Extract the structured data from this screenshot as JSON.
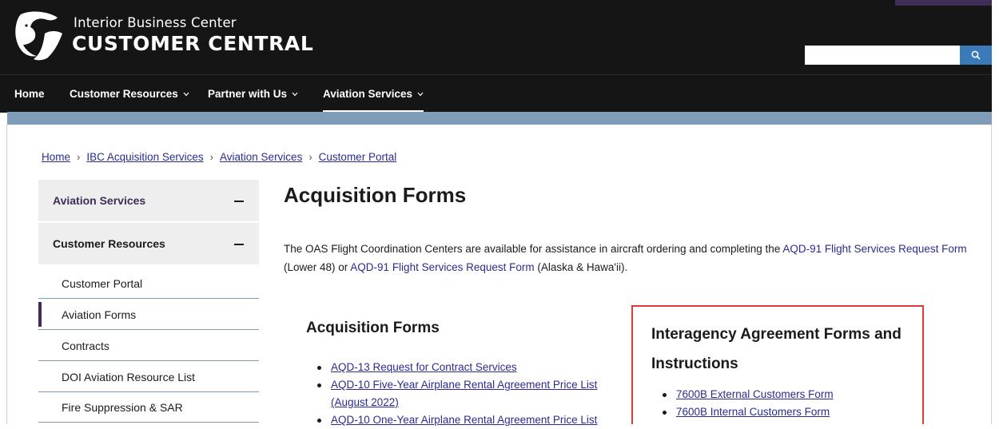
{
  "header": {
    "brand_top": "Interior Business Center",
    "brand_main": "CUSTOMER CENTRAL",
    "search": {
      "placeholder": "",
      "value": ""
    },
    "logo_icon": "bison-logo",
    "search_icon": "search-icon"
  },
  "nav": {
    "items": [
      {
        "label": "Home",
        "has_dropdown": false
      },
      {
        "label": "Customer Resources",
        "has_dropdown": true
      },
      {
        "label": "Partner with Us",
        "has_dropdown": true
      },
      {
        "label": "Aviation Services",
        "has_dropdown": true,
        "active": true
      }
    ]
  },
  "breadcrumb": [
    "Home",
    "IBC Acquisition Services",
    "Aviation Services",
    "Customer Portal"
  ],
  "sidebar": {
    "sections": [
      {
        "label": "Aviation Services",
        "expanded": true,
        "color": "#3d2d58"
      },
      {
        "label": "Customer Resources",
        "expanded": true
      }
    ],
    "links": [
      "Customer Portal",
      "Aviation Forms",
      "Contracts",
      "DOI Aviation Resource List",
      "Fire Suppression & SAR"
    ],
    "current": "Aviation Forms"
  },
  "main": {
    "title": "Acquisition Forms",
    "intro": {
      "text1": "The OAS Flight Coordination Centers are available for assistance in aircraft ordering and completing the ",
      "link1": "AQD-91 Flight Services Request Form",
      "text2": " (Lower 48) or ",
      "link2": "AQD-91 Flight Services Request Form",
      "text3": " (Alaska & Hawa'ii)."
    },
    "acquisition": {
      "heading": "Acquisition Forms",
      "items": [
        "AQD-13 Request for Contract Services",
        "AQD-10 Five-Year Airplane Rental Agreement Price List (August 2022)",
        "AQD-10 One-Year Airplane Rental Agreement Price List"
      ]
    },
    "interagency": {
      "heading_line1": "Interagency Agreement Forms and",
      "heading_line2": "Instructions",
      "items": [
        "7600B External Customers Form",
        "7600B Internal Customers Form"
      ]
    }
  },
  "colors": {
    "header_bg": "#151515",
    "band": "#7f9cb9",
    "accent_purple": "#3d2d58",
    "search_button": "#3a7ab8",
    "highlight": "#e0383e",
    "link": "#2b2b8f"
  }
}
